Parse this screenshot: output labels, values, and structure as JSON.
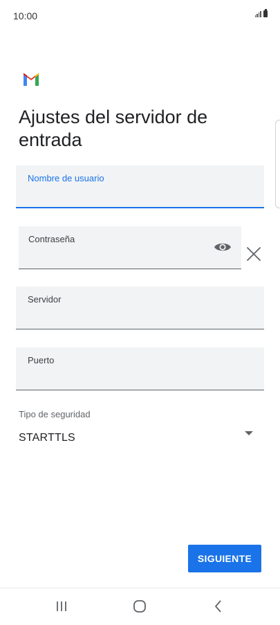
{
  "status_bar": {
    "time": "10:00"
  },
  "page": {
    "title": "Ajustes del servidor de entrada"
  },
  "fields": {
    "username": {
      "label": "Nombre de usuario",
      "value": ""
    },
    "password": {
      "label": "Contraseña",
      "value": ""
    },
    "server": {
      "label": "Servidor",
      "value": ""
    },
    "port": {
      "label": "Puerto",
      "value": ""
    }
  },
  "security": {
    "label": "Tipo de seguridad",
    "value": "STARTTLS"
  },
  "buttons": {
    "next": "SIGUIENTE"
  },
  "icons": {
    "app_logo": "gmail-logo",
    "password_toggle": "eye-icon",
    "clear": "close-icon",
    "dropdown": "triangle-down-icon",
    "nav_recent": "recent-apps-icon",
    "nav_home": "home-icon",
    "nav_back": "back-icon"
  },
  "colors": {
    "accent": "#1a73e8",
    "field_bg": "#f1f3f4"
  }
}
